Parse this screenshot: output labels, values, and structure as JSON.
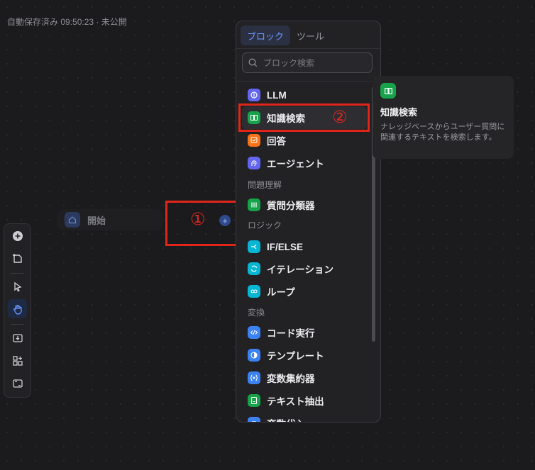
{
  "status": "自動保存済み 09:50:23 · 未公開",
  "start_node": {
    "label": "開始"
  },
  "annotations": {
    "one": "①",
    "two": "②"
  },
  "colors": {
    "accent": "#6b97ff",
    "annotation": "#e0251a"
  },
  "toolbar": {
    "items": [
      "add-block-icon",
      "add-note-icon",
      "pointer-icon",
      "hand-icon",
      "export-icon",
      "organize-icon",
      "fit-view-icon"
    ],
    "active": "hand-icon"
  },
  "panel": {
    "tabs": [
      {
        "label": "ブロック",
        "active": true
      },
      {
        "label": "ツール",
        "active": false
      }
    ],
    "search_placeholder": "ブロック検索",
    "items": [
      {
        "label": "LLM",
        "icon": "llm-icon",
        "color": "#6366f1"
      },
      {
        "label": "知識検索",
        "icon": "book-icon",
        "color": "#16a34a"
      },
      {
        "label": "回答",
        "icon": "reply-icon",
        "color": "#f97316"
      },
      {
        "label": "エージェント",
        "icon": "agent-icon",
        "color": "#6366f1"
      },
      {
        "label": "質問分類器",
        "icon": "classifier-icon",
        "color": "#16a34a"
      },
      {
        "label": "IF/ELSE",
        "icon": "branch-icon",
        "color": "#06b6d4"
      },
      {
        "label": "イテレーション",
        "icon": "iteration-icon",
        "color": "#06b6d4"
      },
      {
        "label": "ループ",
        "icon": "loop-icon",
        "color": "#06b6d4"
      },
      {
        "label": "コード実行",
        "icon": "code-icon",
        "color": "#3b82f6"
      },
      {
        "label": "テンプレート",
        "icon": "template-icon",
        "color": "#3b82f6"
      },
      {
        "label": "変数集約器",
        "icon": "variable-icon",
        "color": "#3b82f6"
      },
      {
        "label": "テキスト抽出",
        "icon": "extract-icon",
        "color": "#16a34a"
      },
      {
        "label": "変数代入",
        "icon": "assign-icon",
        "color": "#3b82f6"
      }
    ],
    "categories": [
      "問題理解",
      "ロジック",
      "変換"
    ]
  },
  "tooltip": {
    "title": "知識検索",
    "description": "ナレッジベースからユーザー質問に関連するテキストを検索します。"
  }
}
